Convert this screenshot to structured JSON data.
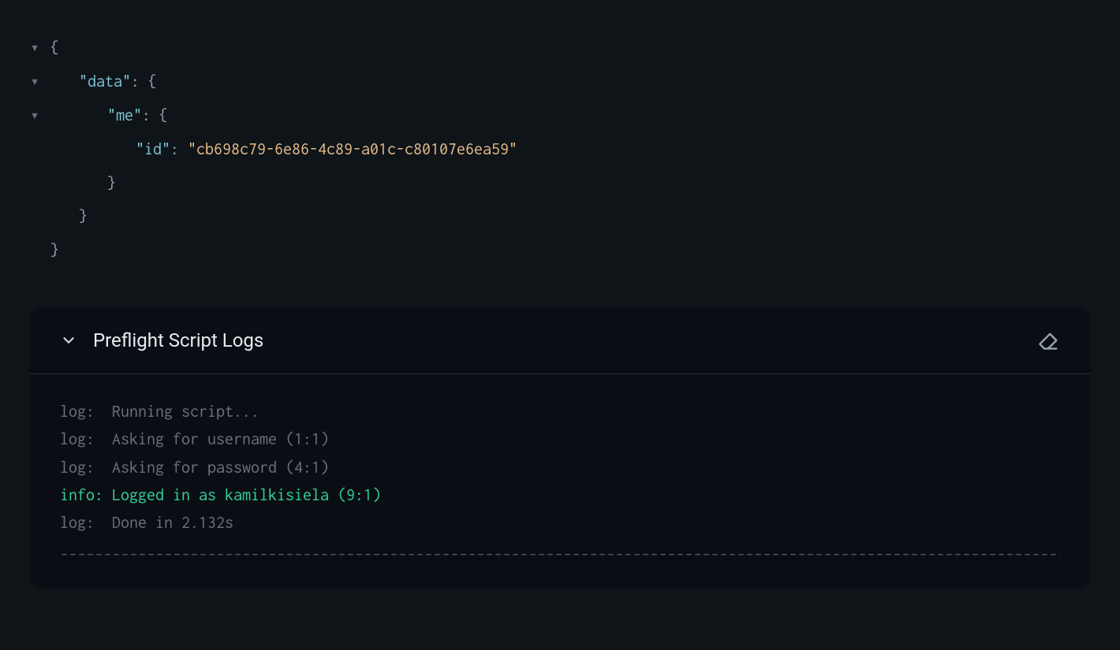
{
  "json": {
    "lines": [
      {
        "toggle": true,
        "indent": 0,
        "content_key": null,
        "content_punct": "{"
      },
      {
        "toggle": true,
        "indent": 1,
        "content_key": "\"data\"",
        "content_punct": ": {"
      },
      {
        "toggle": true,
        "indent": 2,
        "content_key": "\"me\"",
        "content_punct": ": {"
      },
      {
        "toggle": false,
        "indent": 3,
        "content_key": "\"id\"",
        "content_punct": ": ",
        "content_value": "\"cb698c79-6e86-4c89-a01c-c80107e6ea59\""
      },
      {
        "toggle": false,
        "indent": 2,
        "content_key": null,
        "content_punct": "}"
      },
      {
        "toggle": false,
        "indent": 1,
        "content_key": null,
        "content_punct": "}"
      },
      {
        "toggle": false,
        "indent": 0,
        "content_key": null,
        "content_punct": "}"
      }
    ]
  },
  "logs": {
    "title": "Preflight Script Logs",
    "entries": [
      {
        "level": "log",
        "text": "log:  Running script..."
      },
      {
        "level": "log",
        "text": "log:  Asking for username (1:1)"
      },
      {
        "level": "log",
        "text": "log:  Asking for password (4:1)"
      },
      {
        "level": "info",
        "text": "info: Logged in as kamilkisiela (9:1)"
      },
      {
        "level": "log",
        "text": "log:  Done in 2.132s"
      }
    ],
    "divider": "------------------------------------------------------------------------------------------------------------------------------------------"
  },
  "glyphs": {
    "arrow_down": "▼"
  }
}
